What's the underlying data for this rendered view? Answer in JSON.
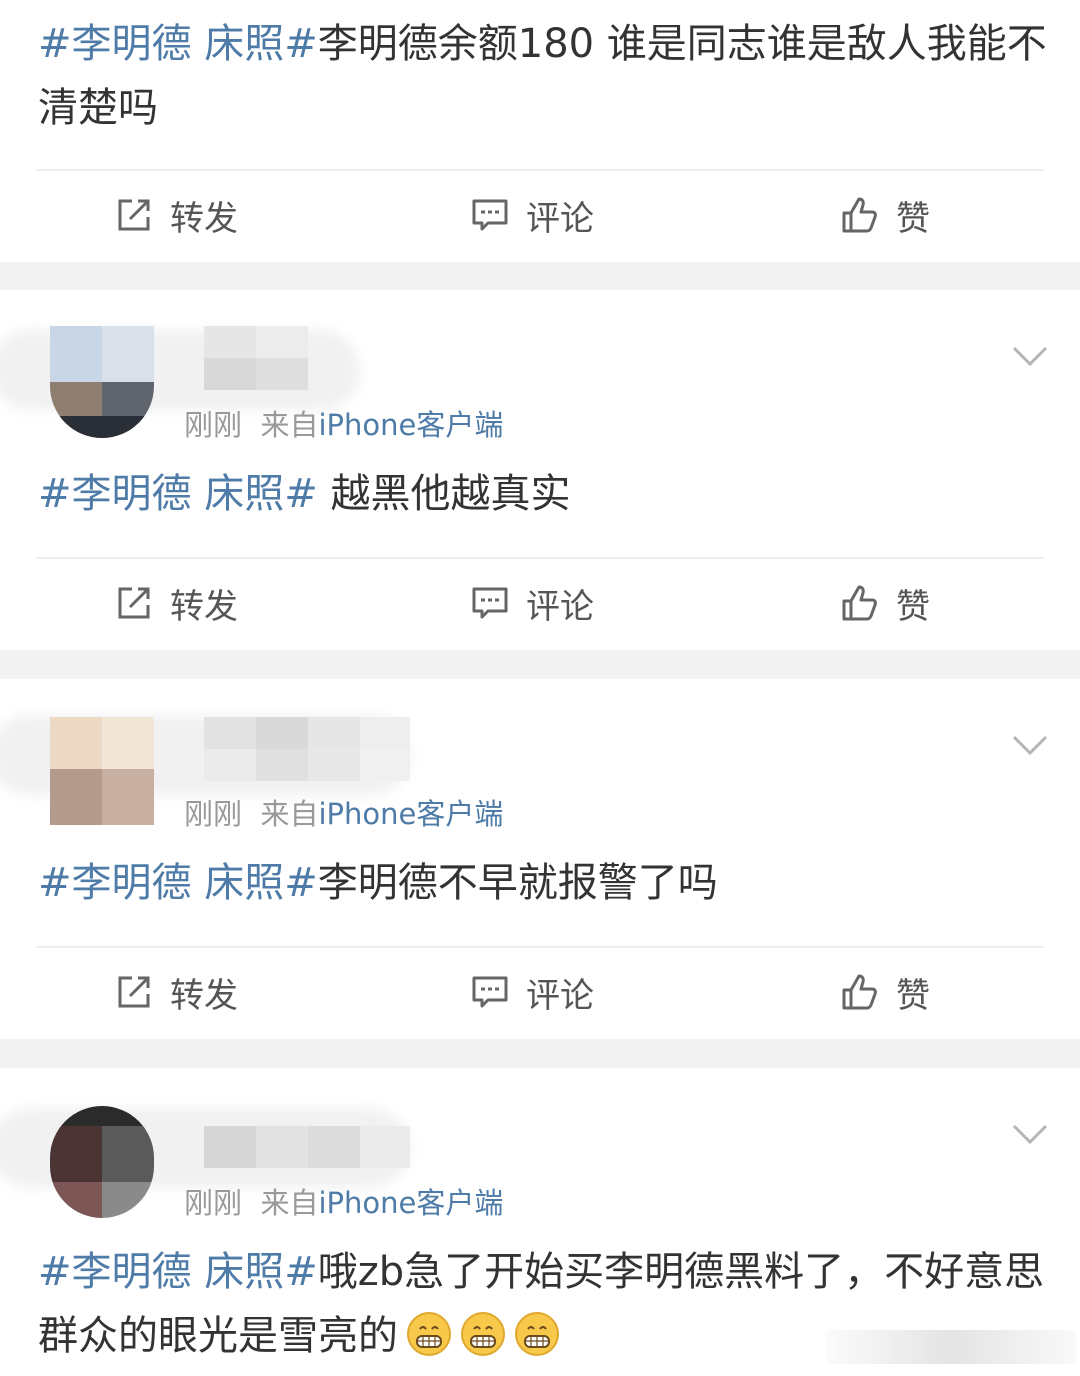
{
  "posts": [
    {
      "tag": "#李明德 床照#",
      "text": "李明德余额180  谁是同志谁是敌人我能不清楚吗",
      "actions": {
        "repost": "转发",
        "comment": "评论",
        "like": "赞"
      }
    },
    {
      "meta_time": "刚刚",
      "meta_from": "来自",
      "meta_source": "iPhone客户端",
      "tag": "#李明德 床照#",
      "text": " 越黑他越真实",
      "actions": {
        "repost": "转发",
        "comment": "评论",
        "like": "赞"
      }
    },
    {
      "meta_time": "刚刚",
      "meta_from": "来自",
      "meta_source": "iPhone客户端",
      "tag": "#李明德 床照#",
      "text": "李明德不早就报警了吗",
      "actions": {
        "repost": "转发",
        "comment": "评论",
        "like": "赞"
      }
    },
    {
      "meta_time": "刚刚",
      "meta_from": "来自",
      "meta_source": "iPhone客户端",
      "tag": "#李明德 床照#",
      "text": "哦zb急了开始买李明德黑料了，不好意思群众的眼光是雪亮的",
      "emoji": [
        "grinning-face",
        "grinning-face",
        "grinning-face"
      ]
    }
  ],
  "colors": {
    "tag": "#4e7ba7",
    "text": "#333333",
    "meta": "#999999",
    "separator": "#f2f2f2"
  }
}
